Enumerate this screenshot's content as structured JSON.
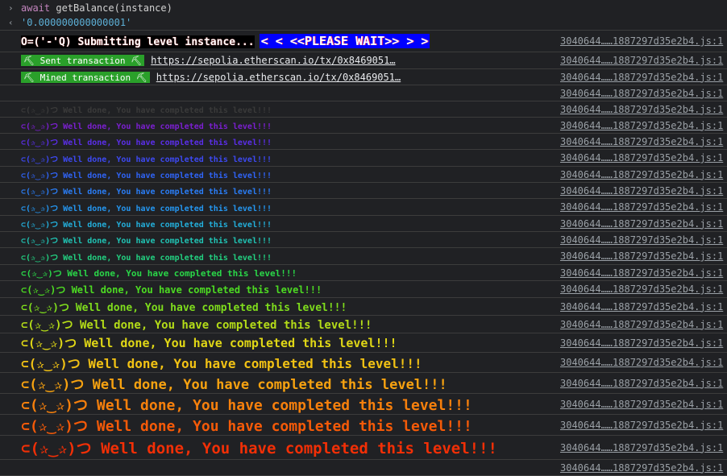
{
  "command": {
    "keyword": "await",
    "call": " getBalance(instance)"
  },
  "result": {
    "value": "'0.000000000000001'"
  },
  "submitting": {
    "part1": "O=('-'Q) Submitting level instance...",
    "part2": "< < <<PLEASE WAIT>> > >"
  },
  "sent_tx": {
    "label": "⛏ Sent transaction ⛏",
    "url": "https://sepolia.etherscan.io/tx/0x8469051…"
  },
  "mined_tx": {
    "label": "⛏ Mined transaction ⛏",
    "url": "https://sepolia.etherscan.io/tx/0x8469051…"
  },
  "source": "3040644……1887297d35e2b4.js:1",
  "done_message": "⊂(✰‿✰)つ Well done, You have completed this level!!!",
  "done_colors": [
    "#3a3a3a",
    "#7b1fd0",
    "#5a2ee8",
    "#3d49f2",
    "#2f63f5",
    "#2a7df5",
    "#2496f0",
    "#23aeda",
    "#20c4b4",
    "#22d080",
    "#2ad648",
    "#4ddb22",
    "#7fdd1c",
    "#b4dc18",
    "#e0d716",
    "#f2c214",
    "#f7a210",
    "#f7800c",
    "#f55a08",
    "#f22f06"
  ]
}
